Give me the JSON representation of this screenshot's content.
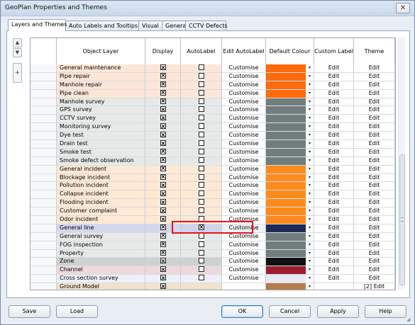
{
  "window": {
    "title": "GeoPlan Properties and Themes",
    "close_glyph": "✕"
  },
  "tabs": [
    "Layers and Themes",
    "Auto Labels and Tooltips",
    "Visual",
    "General",
    "CCTV Defects"
  ],
  "side_buttons": {
    "up": "▲",
    "down": "▼",
    "add": "+"
  },
  "columns": [
    "Object Layer",
    "Display",
    "AutoLabel",
    "Edit AutoLabel",
    "Default Colour",
    "Custom Label",
    "Theme"
  ],
  "rows": [
    {
      "name": "General maintenance",
      "display": true,
      "autolabel": false,
      "edit_autolabel": "Customise",
      "colour": "#ff6a0a",
      "custom_label": "Edit",
      "theme": "Edit",
      "bg": "#fde6d8"
    },
    {
      "name": "Pipe repair",
      "display": true,
      "autolabel": false,
      "edit_autolabel": "Customise",
      "colour": "#ff6a0a",
      "custom_label": "Edit",
      "theme": "Edit",
      "bg": "#fde6d8"
    },
    {
      "name": "Manhole repair",
      "display": true,
      "autolabel": false,
      "edit_autolabel": "Customise",
      "colour": "#ff6a0a",
      "custom_label": "Edit",
      "theme": "Edit",
      "bg": "#fde6d8"
    },
    {
      "name": "Pipe clean",
      "display": true,
      "autolabel": false,
      "edit_autolabel": "Customise",
      "colour": "#ff6a0a",
      "custom_label": "Edit",
      "theme": "Edit",
      "bg": "#fde6d8"
    },
    {
      "name": "Manhole survey",
      "display": true,
      "autolabel": false,
      "edit_autolabel": "Customise",
      "colour": "#717d7c",
      "custom_label": "Edit",
      "theme": "Edit",
      "bg": "#e7e9e9"
    },
    {
      "name": "GPS survey",
      "display": true,
      "autolabel": false,
      "edit_autolabel": "Customise",
      "colour": "#717d7c",
      "custom_label": "Edit",
      "theme": "Edit",
      "bg": "#e7e9e9"
    },
    {
      "name": "CCTV survey",
      "display": true,
      "autolabel": false,
      "edit_autolabel": "Customise",
      "colour": "#717d7c",
      "custom_label": "Edit",
      "theme": "Edit",
      "bg": "#e7e9e9"
    },
    {
      "name": "Monitoring survey",
      "display": true,
      "autolabel": false,
      "edit_autolabel": "Customise",
      "colour": "#717d7c",
      "custom_label": "Edit",
      "theme": "Edit",
      "bg": "#e7e9e9"
    },
    {
      "name": "Dye test",
      "display": true,
      "autolabel": false,
      "edit_autolabel": "Customise",
      "colour": "#717d7c",
      "custom_label": "Edit",
      "theme": "Edit",
      "bg": "#e7e9e9"
    },
    {
      "name": "Drain test",
      "display": true,
      "autolabel": false,
      "edit_autolabel": "Customise",
      "colour": "#717d7c",
      "custom_label": "Edit",
      "theme": "Edit",
      "bg": "#e7e9e9"
    },
    {
      "name": "Smoke test",
      "display": true,
      "autolabel": false,
      "edit_autolabel": "Customise",
      "colour": "#717d7c",
      "custom_label": "Edit",
      "theme": "Edit",
      "bg": "#e7e9e9"
    },
    {
      "name": "Smoke defect observation",
      "display": true,
      "autolabel": false,
      "edit_autolabel": "Customise",
      "colour": "#717d7c",
      "custom_label": "Edit",
      "theme": "Edit",
      "bg": "#e7e9e9"
    },
    {
      "name": "General incident",
      "display": true,
      "autolabel": false,
      "edit_autolabel": "Customise",
      "colour": "#ff8a1c",
      "custom_label": "Edit",
      "theme": "Edit",
      "bg": "#fde9d4"
    },
    {
      "name": "Blockage incident",
      "display": true,
      "autolabel": false,
      "edit_autolabel": "Customise",
      "colour": "#ff8a1c",
      "custom_label": "Edit",
      "theme": "Edit",
      "bg": "#fde9d4"
    },
    {
      "name": "Pollution incident",
      "display": true,
      "autolabel": false,
      "edit_autolabel": "Customise",
      "colour": "#ff8a1c",
      "custom_label": "Edit",
      "theme": "Edit",
      "bg": "#fde9d4"
    },
    {
      "name": "Collapse incident",
      "display": true,
      "autolabel": false,
      "edit_autolabel": "Customise",
      "colour": "#ff8a1c",
      "custom_label": "Edit",
      "theme": "Edit",
      "bg": "#fde9d4"
    },
    {
      "name": "Flooding incident",
      "display": true,
      "autolabel": false,
      "edit_autolabel": "Customise",
      "colour": "#ff8a1c",
      "custom_label": "Edit",
      "theme": "Edit",
      "bg": "#fde9d4"
    },
    {
      "name": "Customer complaint",
      "display": true,
      "autolabel": false,
      "edit_autolabel": "Customise",
      "colour": "#ff8a1c",
      "custom_label": "Edit",
      "theme": "Edit",
      "bg": "#fde9d4"
    },
    {
      "name": "Odor incident",
      "display": true,
      "autolabel": false,
      "edit_autolabel": "Customise",
      "colour": "#ff8a1c",
      "custom_label": "Edit",
      "theme": "Edit",
      "bg": "#fde9d4"
    },
    {
      "name": "General line",
      "display": true,
      "autolabel": true,
      "edit_autolabel": "Customise",
      "colour": "#1f2b57",
      "custom_label": "Edit",
      "theme": "Edit",
      "bg": "#d3d6ec",
      "selected": true
    },
    {
      "name": "General survey",
      "display": true,
      "autolabel": false,
      "edit_autolabel": "Customise",
      "colour": "#717d7c",
      "custom_label": "Edit",
      "theme": "Edit",
      "bg": "#e7e9e9"
    },
    {
      "name": "FOG inspection",
      "display": true,
      "autolabel": false,
      "edit_autolabel": "Customise",
      "colour": "#717d7c",
      "custom_label": "Edit",
      "theme": "Edit",
      "bg": "#e7e9e9"
    },
    {
      "name": "Property",
      "display": true,
      "autolabel": false,
      "edit_autolabel": "Customise",
      "colour": "#717d7c",
      "custom_label": "Edit",
      "theme": "Edit",
      "bg": "#e7e9e9"
    },
    {
      "name": "Zone",
      "display": true,
      "autolabel": false,
      "edit_autolabel": "Customise",
      "colour": "#111111",
      "custom_label": "Edit",
      "theme": "Edit",
      "bg": "#cfd1d1"
    },
    {
      "name": "Channel",
      "display": true,
      "autolabel": false,
      "edit_autolabel": "Customise",
      "colour": "#9c1f2f",
      "custom_label": "Edit",
      "theme": "Edit",
      "bg": "#ecd9dc"
    },
    {
      "name": "Cross section survey",
      "display": true,
      "autolabel": false,
      "edit_autolabel": "Customise",
      "colour": "#e7e9f5",
      "custom_label": "Edit",
      "theme": "Edit",
      "bg": "#eef0f8"
    },
    {
      "name": "Ground Model",
      "display": true,
      "autolabel": null,
      "edit_autolabel": "",
      "colour": "#b87a4a",
      "custom_label": "",
      "theme": "[2] Edit",
      "bg": "#f2e2cc"
    }
  ],
  "dropdown_glyph": "▾",
  "buttons": {
    "save": "Save",
    "load": "Load",
    "ok": "OK",
    "cancel": "Cancel",
    "apply": "Apply",
    "help": "Help"
  }
}
